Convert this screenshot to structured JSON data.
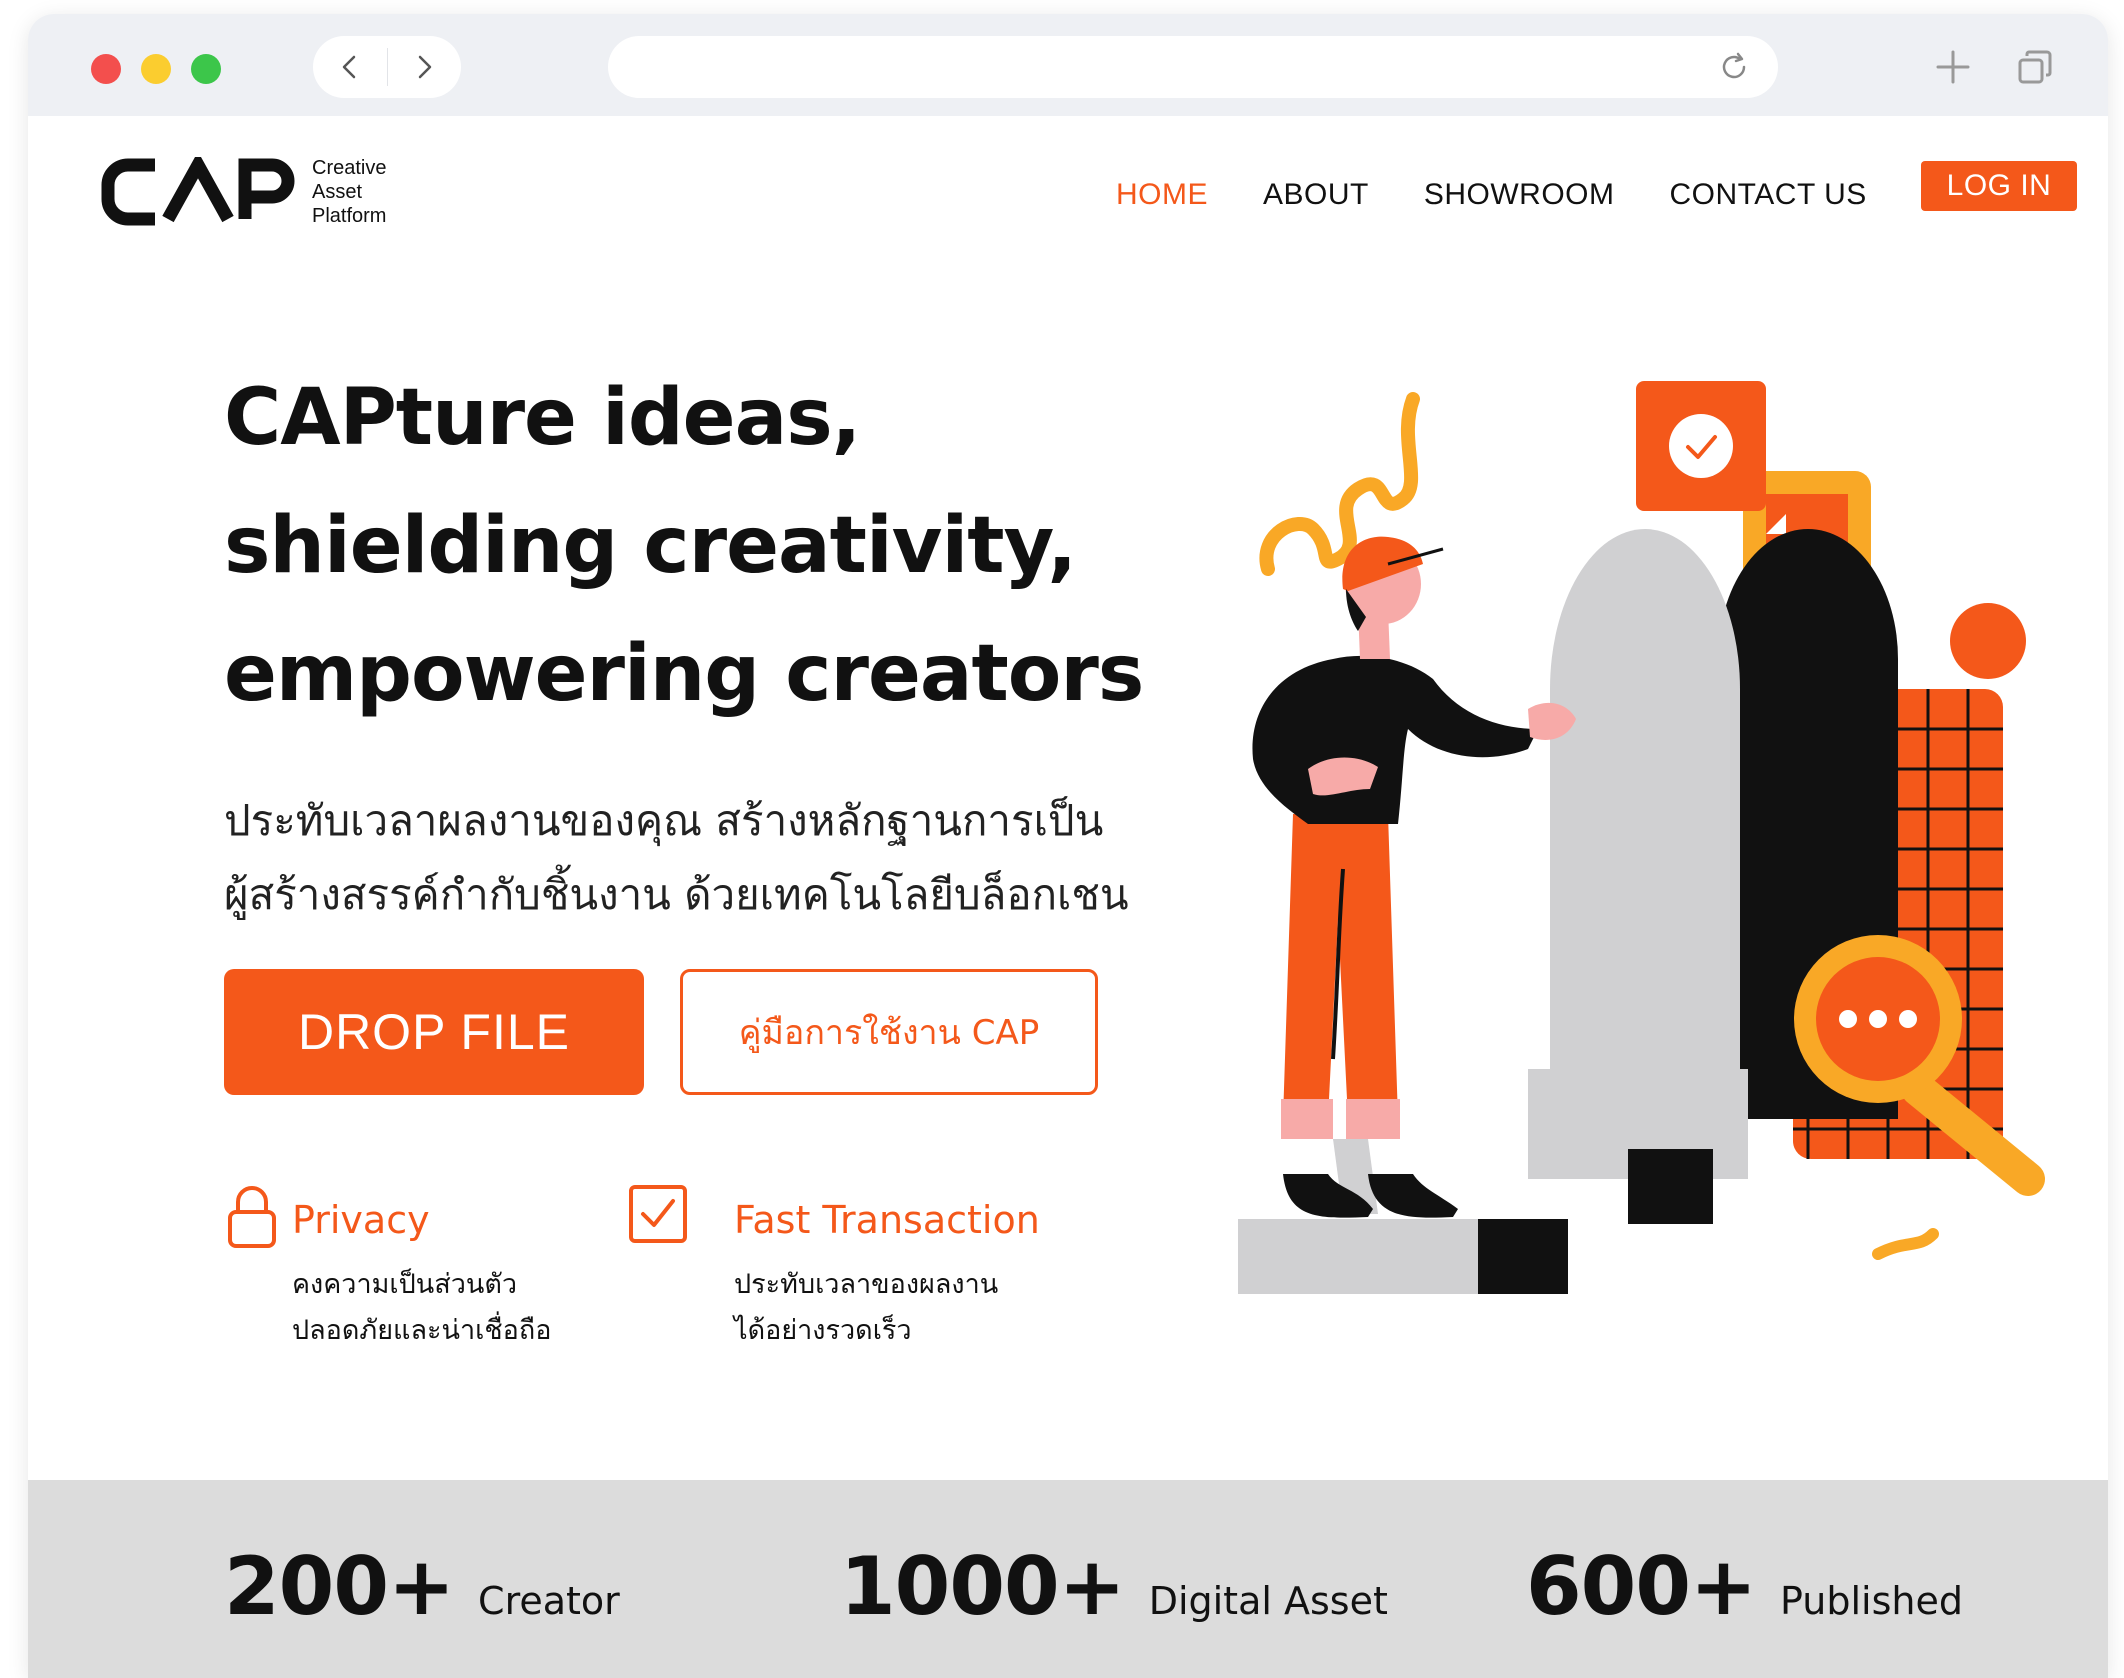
{
  "browser": {
    "controls": [
      "close",
      "minimize",
      "maximize"
    ],
    "icons": [
      "back-icon",
      "forward-icon",
      "reload-icon",
      "new-tab-icon",
      "tabs-overview-icon"
    ]
  },
  "brand": {
    "logo_text": "CAP",
    "tagline": [
      "Creative",
      "Asset",
      "Platform"
    ]
  },
  "nav": {
    "items": [
      {
        "label": "HOME",
        "active": true
      },
      {
        "label": "ABOUT",
        "active": false
      },
      {
        "label": "SHOWROOM",
        "active": false
      },
      {
        "label": "CONTACT US",
        "active": false
      }
    ],
    "login_label": "LOG IN"
  },
  "hero": {
    "title_lines": [
      "CAPture ideas,",
      "shielding creativity,",
      "empowering creators"
    ],
    "subtitle_lines": [
      "ประทับเวลาผลงานของคุณ สร้างหลักฐานการเป็น",
      "ผู้สร้างสรรค์กำกับชิ้นงาน ด้วยเทคโนโลยีบล็อกเชน"
    ],
    "primary_cta": "DROP FILE",
    "secondary_cta": "คู่มือการใช้งาน CAP"
  },
  "features": [
    {
      "icon": "lock-icon",
      "title": "Privacy",
      "desc": [
        "คงความเป็นส่วนตัว",
        "ปลอดภัยและน่าเชื่อถือ"
      ]
    },
    {
      "icon": "checkbox-icon",
      "title": "Fast Transaction",
      "desc": [
        "ประทับเวลาของผลงาน",
        "ได้อย่างรวดเร็ว"
      ]
    }
  ],
  "stats": [
    {
      "value": "200+",
      "label": "Creator"
    },
    {
      "value": "1000+",
      "label": "Digital Asset"
    },
    {
      "value": "600+",
      "label": "Published"
    }
  ],
  "colors": {
    "accent": "#f4581a",
    "yellow": "#f9a826",
    "dark": "#111111",
    "stats_bg": "#dcdcdc",
    "chrome_bg": "#eef0f4"
  }
}
